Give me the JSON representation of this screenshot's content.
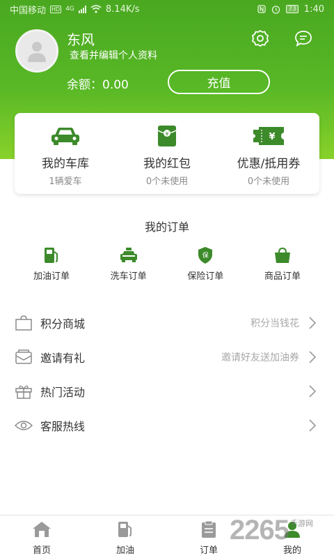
{
  "status_bar": {
    "carrier": "中国移动",
    "hd": "HD",
    "network": "4G",
    "speed": "8.14K/s",
    "battery": "73",
    "time": "1:40"
  },
  "profile": {
    "name": "东风",
    "edit_link": "查看并编辑个人资料",
    "balance_label": "余额：",
    "balance_value": "0.00",
    "recharge_label": "充值"
  },
  "card": [
    {
      "title": "我的车库",
      "sub": "1辆爱车",
      "icon": "car-icon"
    },
    {
      "title": "我的红包",
      "sub": "0个未使用",
      "icon": "red-envelope-icon"
    },
    {
      "title": "优惠/抵用券",
      "sub": "0个未使用",
      "icon": "coupon-icon"
    }
  ],
  "orders": {
    "title": "我的订单",
    "items": [
      {
        "label": "加油订单",
        "icon": "fuel-pump-icon"
      },
      {
        "label": "洗车订单",
        "icon": "car-wash-icon"
      },
      {
        "label": "保险订单",
        "icon": "insurance-shield-icon",
        "badge": "保"
      },
      {
        "label": "商品订单",
        "icon": "shopping-bag-icon"
      }
    ]
  },
  "menu": [
    {
      "label": "积分商城",
      "hint": "积分当钱花",
      "icon": "bag-icon"
    },
    {
      "label": "邀请有礼",
      "hint": "邀请好友送加油券",
      "icon": "envelope-icon"
    },
    {
      "label": "热门活动",
      "hint": "",
      "icon": "gift-icon"
    },
    {
      "label": "客服热线",
      "hint": "",
      "icon": "eye-icon"
    }
  ],
  "bottom_nav": [
    {
      "label": "首页",
      "icon": "home-icon"
    },
    {
      "label": "加油",
      "icon": "fuel-icon"
    },
    {
      "label": "订单",
      "icon": "clipboard-icon"
    },
    {
      "label": "我的",
      "icon": "person-icon",
      "active": true
    }
  ],
  "watermark": {
    "number": "2265",
    "text": "手游网"
  },
  "colors": {
    "brand_green": "#58b826",
    "icon_green": "#3c8a2a"
  }
}
